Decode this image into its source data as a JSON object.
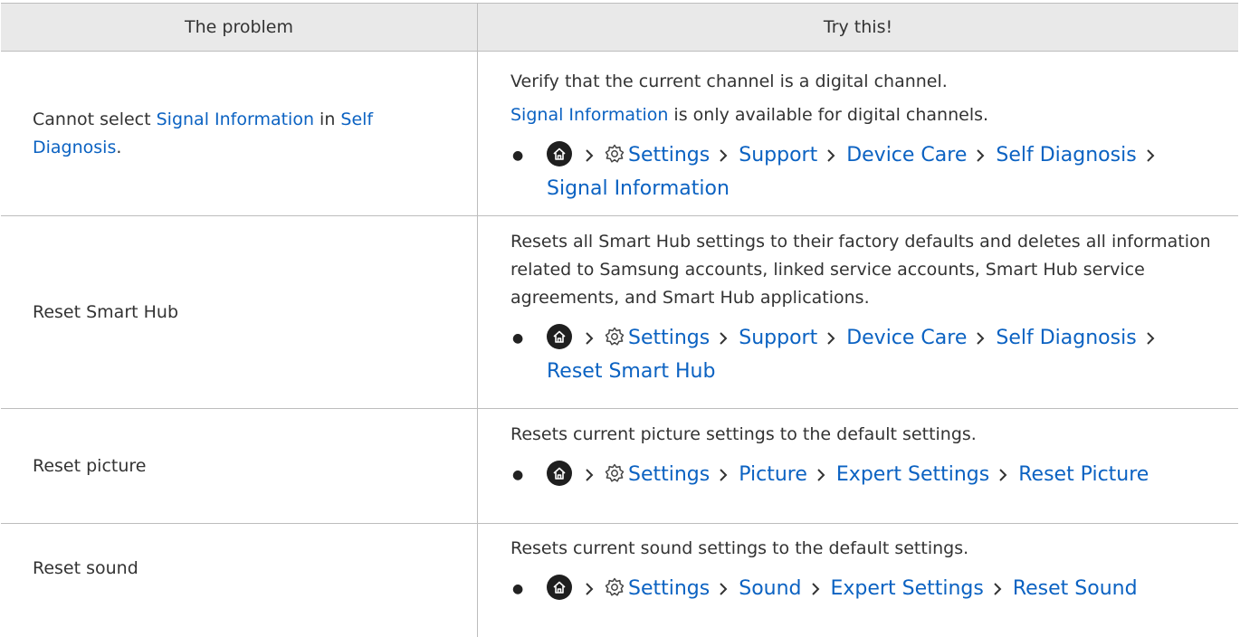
{
  "header": {
    "problem": "The problem",
    "try": "Try this!"
  },
  "rows": [
    {
      "problem": {
        "prefix": "Cannot select ",
        "link1": "Signal Information",
        "mid": " in ",
        "link2": "Self Diagnosis",
        "suffix": "."
      },
      "desc_line1": "Verify that the current channel is a digital channel.",
      "desc_link": "Signal Information",
      "desc_line2": " is only available for digital channels.",
      "path": [
        "Settings",
        "Support",
        "Device Care",
        "Self Diagnosis",
        "Signal Information"
      ]
    },
    {
      "problem": "Reset Smart Hub",
      "desc": "Resets all Smart Hub settings to their factory defaults and deletes all information related to Samsung accounts, linked service accounts, Smart Hub service agreements, and Smart Hub applications.",
      "path": [
        "Settings",
        "Support",
        "Device Care",
        "Self Diagnosis",
        "Reset Smart Hub"
      ]
    },
    {
      "problem": "Reset picture",
      "desc": "Resets current picture settings to the default settings.",
      "path": [
        "Settings",
        "Picture",
        "Expert Settings",
        "Reset Picture"
      ]
    },
    {
      "problem": "Reset sound",
      "desc": "Resets current sound settings to the default settings.",
      "path": [
        "Settings",
        "Sound",
        "Expert Settings",
        "Reset Sound"
      ]
    }
  ],
  "colors": {
    "link": "#0b62c2",
    "header_bg": "#e9e9e9",
    "text": "#333333",
    "border": "#bdbdbd"
  },
  "icons": {
    "home": "home-icon",
    "settings": "gear-icon",
    "separator": "chevron-right-icon",
    "bullet": "bullet-icon"
  }
}
